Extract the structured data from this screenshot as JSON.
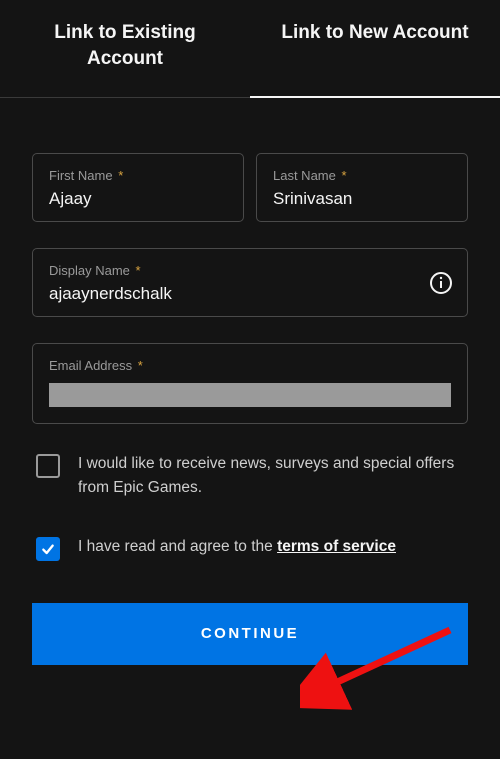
{
  "tabs": {
    "existing": "Link to Existing Account",
    "new": "Link to New Account"
  },
  "fields": {
    "firstName": {
      "label": "First Name",
      "value": "Ajaay"
    },
    "lastName": {
      "label": "Last Name",
      "value": "Srinivasan"
    },
    "displayName": {
      "label": "Display Name",
      "value": "ajaaynerdschalk"
    },
    "email": {
      "label": "Email Address"
    }
  },
  "required_marker": "*",
  "checkboxes": {
    "news": "I would like to receive news, surveys and special offers from Epic Games.",
    "tos_prefix": "I have read and agree to the ",
    "tos_link": "terms of service"
  },
  "button": {
    "continue": "CONTINUE"
  }
}
